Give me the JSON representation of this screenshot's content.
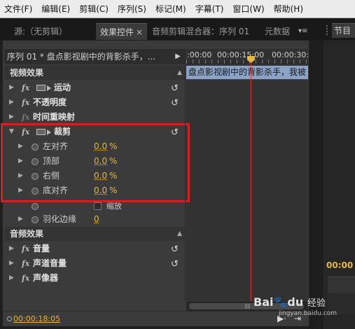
{
  "menu": [
    "文件(F)",
    "编辑(E)",
    "剪辑(C)",
    "序列(S)",
    "标记(M)",
    "字幕(T)",
    "窗口(W)",
    "帮助(H)"
  ],
  "tabs": {
    "source": "源:（无剪辑）",
    "effect_controls": "效果控件",
    "audio_mixer": "音频剪辑混合器：序列 01",
    "metadata": "元数据",
    "program": "节目"
  },
  "sequence_label": "序列 01 * 盘点影视剧中的背影杀手，...",
  "ruler": {
    "start": ":00:00",
    "mid": "00:00:15:00",
    "end": "00:00:30:"
  },
  "clip_name": "盘点影视剧中的背影杀手，我被",
  "sections": {
    "video": "视频效果",
    "audio": "音频效果"
  },
  "effects": {
    "motion": "运动",
    "opacity": "不透明度",
    "time_remap": "时间重映射",
    "crop": "裁剪",
    "crop_left": "左对齐",
    "crop_top": "顶部",
    "crop_right": "右侧",
    "crop_bottom": "底对齐",
    "zoom_label": "缩放",
    "feather": "羽化边缘",
    "volume": "音量",
    "channel_volume": "声道音量",
    "panner": "声像器"
  },
  "values": {
    "left": "0.0",
    "top": "0.0",
    "right": "0.0",
    "bottom": "0.0",
    "unit": "%",
    "feather": "0"
  },
  "fx_label": "fx",
  "footer_timecode": "00:00:18:05",
  "program_timecode": "00:00",
  "watermark": {
    "brand": "Bai",
    "du": "du",
    "jingyan": "经验",
    "url": "jingyan.baidu.com"
  },
  "colors": {
    "accent": "#e8b63a",
    "playhead": "#dd3333",
    "clip": "#8aa3c6",
    "highlight": "#d92020"
  }
}
